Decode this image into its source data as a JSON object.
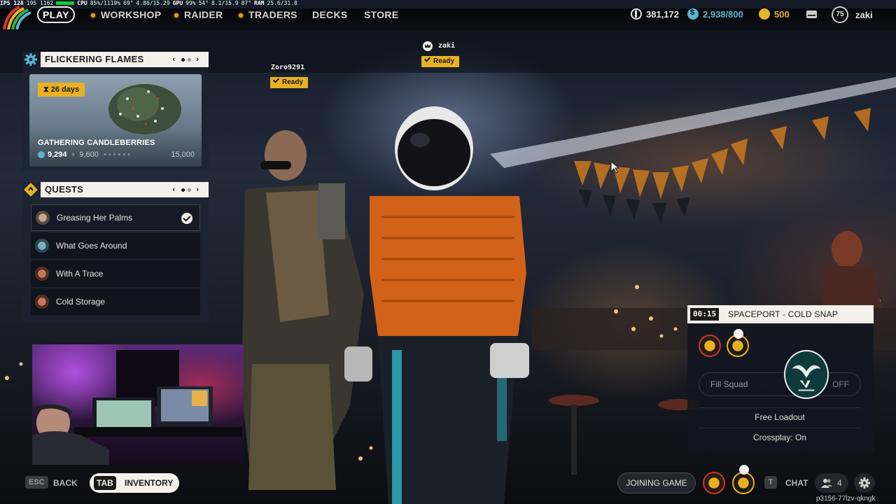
{
  "perf": {
    "fps": "IPS 128",
    "fps_range": "195 1162",
    "cpu_label": "CPU",
    "cpu": "85%/1119%",
    "temp1": "69°",
    "mem": "4.86/15.29",
    "gpu_label": "GPU",
    "gpu": "99%",
    "temp2": "54°",
    "gpu_mem": "8.1/15.9",
    "temp3": "87°",
    "ram_label": "RAM",
    "ram": "25.6/31.8"
  },
  "nav": {
    "play": "PLAY",
    "items": [
      "WORKSHOP",
      "RAIDER",
      "TRADERS",
      "DECKS",
      "STORE"
    ]
  },
  "currency": {
    "coins": "381,172",
    "raider_tokens": "2,938/800",
    "gold": "500"
  },
  "profile": {
    "level": "75",
    "username": "zaki"
  },
  "event": {
    "title": "FLICKERING FLAMES",
    "days_left": "26 days",
    "card_title": "GATHERING CANDLEBERRIES",
    "current": "9,294",
    "next_goal": "9,600",
    "max_goal": "15,000",
    "progress_fraction": 0.62
  },
  "quests": {
    "title": "QUESTS",
    "items": [
      {
        "label": "Greasing Her Palms",
        "done": true
      },
      {
        "label": "What Goes Around",
        "done": false
      },
      {
        "label": "With A Trace",
        "done": false
      },
      {
        "label": "Cold Storage",
        "done": false
      }
    ]
  },
  "squad": {
    "player_left": {
      "name": "Zoro9291",
      "status": "Ready"
    },
    "player_right": {
      "name": "zaki",
      "status": "Ready"
    }
  },
  "lobby": {
    "timer": "00:15",
    "map": "SPACEPORT - COLD SNAP",
    "fill_squad_label": "Fill Squad",
    "fill_squad_value": "OFF",
    "free_loadout": "Free Loadout",
    "crossplay": "Crossplay: On"
  },
  "bottom": {
    "esc_key": "ESC",
    "back": "BACK",
    "tab_key": "TAB",
    "inventory": "INVENTORY",
    "joining": "JOINING GAME",
    "chat_key": "T",
    "chat": "CHAT",
    "friends_count": "4",
    "session_id": "p3156-77lzv-qkngk"
  },
  "colors": {
    "accent_yellow": "#e8b124",
    "accent_red": "#c43a2a",
    "panel_cream": "#f3f1ea",
    "raider_blue": "#58b7cf"
  }
}
